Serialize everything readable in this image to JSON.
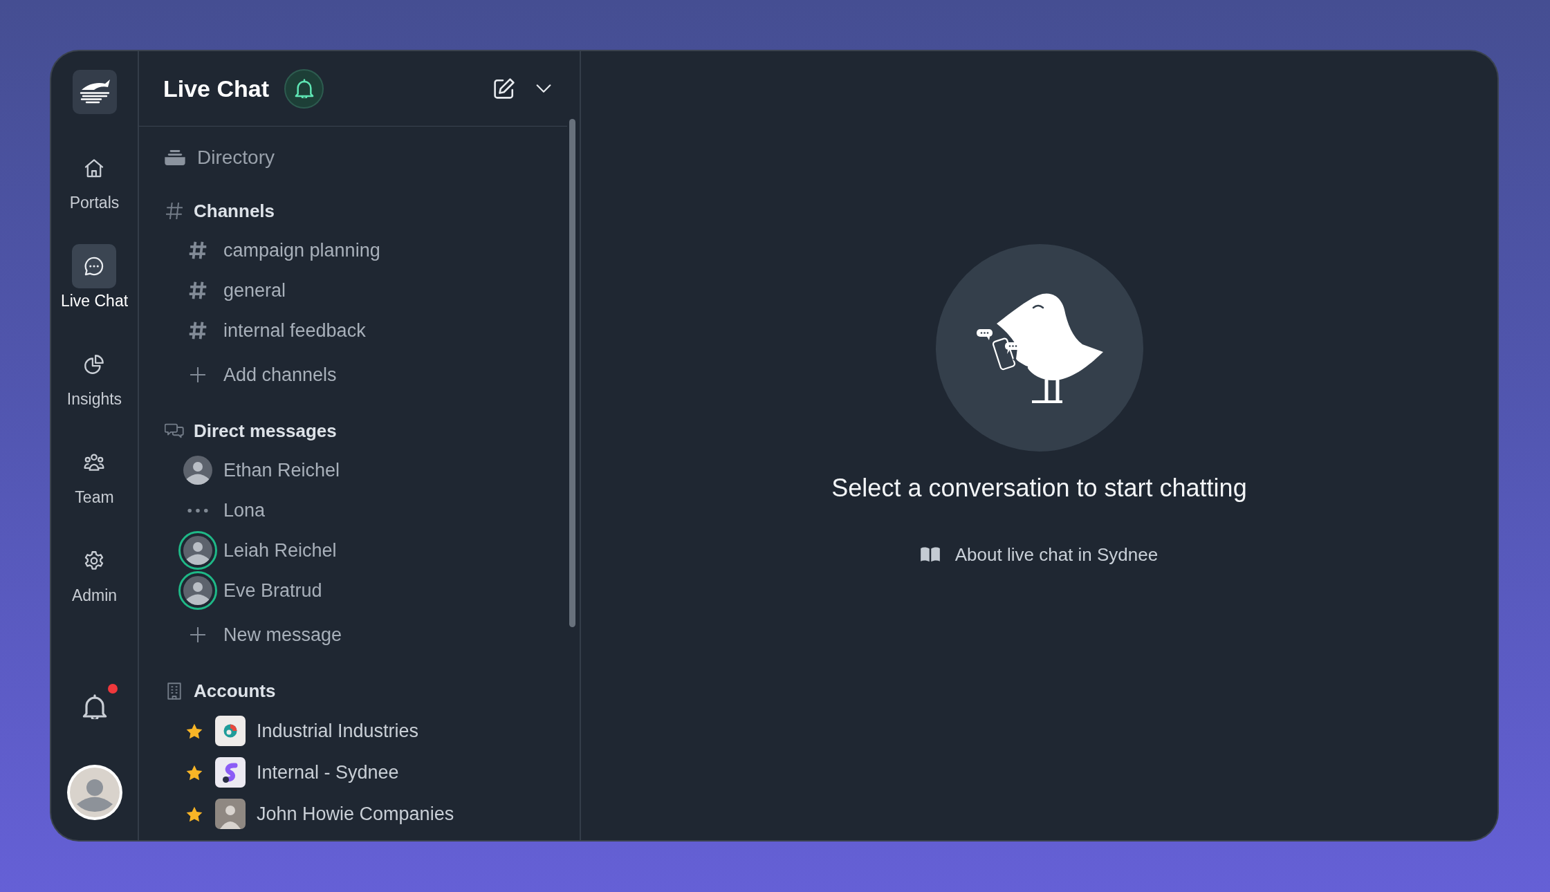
{
  "nav_rail": {
    "items": [
      {
        "label": "Portals",
        "selected": false
      },
      {
        "label": "Live Chat",
        "selected": true
      },
      {
        "label": "Insights",
        "selected": false
      },
      {
        "label": "Team",
        "selected": false
      },
      {
        "label": "Admin",
        "selected": false
      }
    ],
    "notifications": {
      "unread": true
    }
  },
  "sidebar": {
    "title": "Live Chat",
    "directory": {
      "label": "Directory"
    },
    "sections": [
      {
        "kind": "channels",
        "title": "Channels",
        "items": [
          {
            "name": "campaign planning"
          },
          {
            "name": "general"
          },
          {
            "name": "internal feedback"
          }
        ],
        "add_label": "Add channels"
      },
      {
        "kind": "direct_messages",
        "title": "Direct messages",
        "items": [
          {
            "name": "Ethan Reichel",
            "kind": "photo",
            "online": false
          },
          {
            "name": "Lona",
            "kind": "no_photo",
            "online": false
          },
          {
            "name": "Leiah Reichel",
            "kind": "photo",
            "online": true
          },
          {
            "name": "Eve Bratrud",
            "kind": "photo",
            "online": true
          }
        ],
        "add_label": "New message"
      },
      {
        "kind": "accounts",
        "title": "Accounts",
        "items": [
          {
            "name": "Industrial Industries",
            "kind": "logo",
            "starred": true
          },
          {
            "name": "Internal - Sydnee",
            "kind": "logo",
            "starred": true
          },
          {
            "name": "John Howie Companies",
            "kind": "photo",
            "starred": true
          }
        ]
      }
    ]
  },
  "main": {
    "empty_state": {
      "heading": "Select a conversation to start chatting",
      "help_link": "About live chat in Sydnee"
    }
  }
}
